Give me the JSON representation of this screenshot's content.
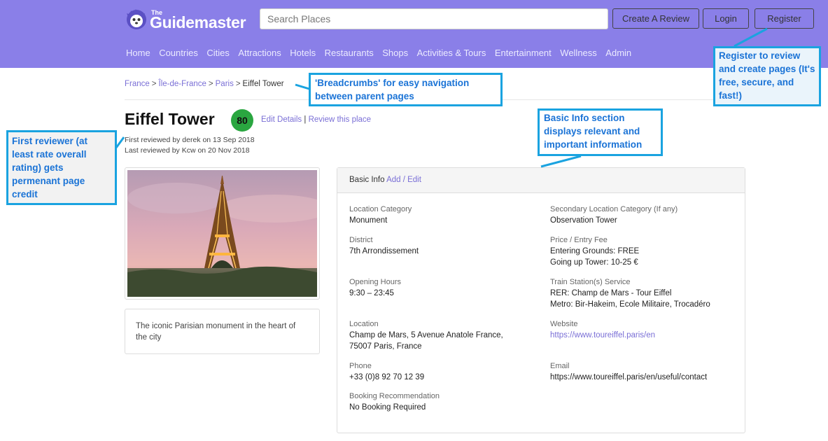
{
  "header": {
    "logo_small": "The",
    "logo_text": "Guidemaster",
    "search_placeholder": "Search Places",
    "buttons": {
      "create_review": "Create A Review",
      "login": "Login",
      "register": "Register"
    },
    "nav": [
      "Home",
      "Countries",
      "Cities",
      "Attractions",
      "Hotels",
      "Restaurants",
      "Shops",
      "Activities & Tours",
      "Entertainment",
      "Wellness",
      "Admin"
    ]
  },
  "breadcrumb": {
    "items": [
      "France",
      "Île-de-France",
      "Paris"
    ],
    "current": "Eiffel Tower",
    "separator": ">"
  },
  "place": {
    "title": "Eiffel Tower",
    "score": "80",
    "edit_details": "Edit Details",
    "divider": "|",
    "review_place": "Review this place",
    "first_reviewed": "First reviewed by derek on 13 Sep 2018",
    "last_reviewed": "Last reviewed by Kcw on 20 Nov 2018",
    "description": "The iconic Parisian monument in the heart of the city"
  },
  "basic_info": {
    "title": "Basic Info",
    "add_edit": "Add / Edit",
    "location_category": {
      "label": "Location Category",
      "value": "Monument"
    },
    "secondary_category": {
      "label": "Secondary Location Category (If any)",
      "value": "Observation Tower"
    },
    "district": {
      "label": "District",
      "value": "7th Arrondissement"
    },
    "price": {
      "label": "Price / Entry Fee",
      "line1": "Entering Grounds: FREE",
      "line2": "Going up Tower: 10-25 €"
    },
    "opening_hours": {
      "label": "Opening Hours",
      "value": "9:30 – 23:45"
    },
    "train": {
      "label": "Train Station(s) Service",
      "line1": "RER: Champ de Mars - Tour Eiffel",
      "line2": "Metro: Bir-Hakeim, Ecole Militaire, Trocadéro"
    },
    "location": {
      "label": "Location",
      "line1": "Champ de Mars, 5 Avenue Anatole France,",
      "line2": "75007 Paris, France"
    },
    "website": {
      "label": "Website",
      "value": "https://www.toureiffel.paris/en"
    },
    "phone": {
      "label": "Phone",
      "value": "+33 (0)8 92 70 12 39"
    },
    "email": {
      "label": "Email",
      "value": "https://www.toureiffel.paris/en/useful/contact"
    },
    "booking": {
      "label": "Booking Recommendation",
      "value": "No Booking Required"
    }
  },
  "callouts": {
    "first_reviewer": "First reviewer (at least rate overall rating) gets permenant page credit",
    "breadcrumbs": "'Breadcrumbs' for easy navigation between parent pages",
    "basic_info": "Basic Info section displays relevant and important information",
    "register": "Register to review and create pages (It's free, secure, and fast!)"
  },
  "colors": {
    "header_bg": "#8a7fe8",
    "link": "#7a6fd6",
    "score_bg": "#2aa640",
    "callout_border": "#1aa3e0",
    "callout_text": "#1a73d6"
  },
  "icons": {
    "logo": "hedgehog-logo-icon"
  }
}
